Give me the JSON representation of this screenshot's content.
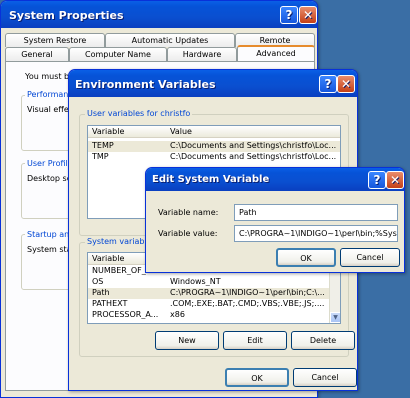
{
  "sysprops": {
    "title": "System Properties",
    "help_glyph": "?",
    "close_glyph": "✕",
    "tabs_row1": [
      "System Restore",
      "Automatic Updates",
      "Remote"
    ],
    "tabs_row2": [
      "General",
      "Computer Name",
      "Hardware",
      "Advanced"
    ],
    "intro_text": "You must be",
    "group_performance": "Performance",
    "performance_text": "Visual effec",
    "group_userprofiles": "User Profiles",
    "userprofiles_text": "Desktop se",
    "group_startup": "Startup and",
    "startup_text": "System star"
  },
  "envvars": {
    "title": "Environment Variables",
    "user_group_label": "User variables for christfo",
    "col_variable": "Variable",
    "col_value": "Value",
    "user_rows": [
      {
        "name": "TEMP",
        "value": "C:\\Documents and Settings\\christfo\\Loc..."
      },
      {
        "name": "TMP",
        "value": "C:\\Documents and Settings\\christfo\\Loc..."
      }
    ],
    "system_group_label": "System variables",
    "system_rows": [
      {
        "name": "NUMBER_OF_P",
        "value": ""
      },
      {
        "name": "OS",
        "value": "Windows_NT"
      },
      {
        "name": "Path",
        "value": "C:\\PROGRA~1\\INDIGO~1\\perl\\bin;C:\\..."
      },
      {
        "name": "PATHEXT",
        "value": ".COM;.EXE;.BAT;.CMD;.VBS;.VBE;.JS;...."
      },
      {
        "name": "PROCESSOR_A...",
        "value": "x86"
      }
    ],
    "btn_new": "New",
    "btn_edit": "Edit",
    "btn_delete": "Delete",
    "btn_ok": "OK",
    "btn_cancel": "Cancel"
  },
  "editsys": {
    "title": "Edit System Variable",
    "name_label": "Variable name:",
    "name_value": "Path",
    "value_label": "Variable value:",
    "value_value": "C:\\PROGRA~1\\INDIGO~1\\perl\\bin;%Syste",
    "btn_ok": "OK",
    "btn_cancel": "Cancel"
  },
  "colors": {
    "desktop": "#3a6ea5",
    "titlebar": "#0a5fe6",
    "window_bg": "#ece9d8",
    "group_title": "#0046d5"
  }
}
